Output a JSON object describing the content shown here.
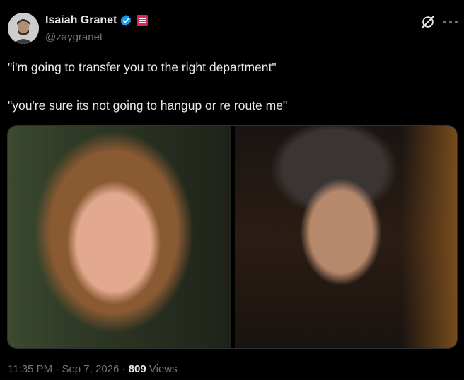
{
  "author": {
    "display_name": "Isaiah Granet",
    "handle": "@zaygranet",
    "verified_icon": "verified-badge-icon",
    "affiliation_icon": "affiliation-badge-icon"
  },
  "header_actions": {
    "grok_icon": "grok-icon",
    "more_icon": "more-horizontal-icon"
  },
  "tweet": {
    "line1": "\"i'm going to transfer you to the right department\"",
    "line2": "\"you're sure its not going to hangup or re route me\""
  },
  "media": {
    "count": 2
  },
  "footer": {
    "time": "11:35 PM",
    "separator": "·",
    "date": "Sep 7, 2026",
    "views_count": "809",
    "views_label": "Views"
  },
  "colors": {
    "background": "#000000",
    "text_primary": "#e7e9ea",
    "text_secondary": "#71767b",
    "verified_blue": "#1d9bf0",
    "affiliation_red": "#e0245e"
  }
}
